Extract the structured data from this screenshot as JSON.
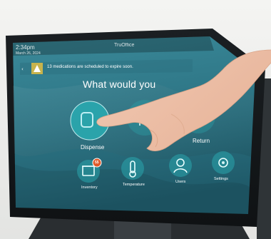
{
  "status_bar": {
    "time": "2:34pm",
    "date": "March 26, 2024",
    "brand": "TruOffice"
  },
  "alert": {
    "message": "13 medications are scheduled to expire soon."
  },
  "main": {
    "heading": "What would you"
  },
  "big_tiles": [
    {
      "label": "Dispense",
      "icon": "hand-pill-icon"
    },
    {
      "label": "",
      "icon": "upload-icon"
    },
    {
      "label": "Return",
      "icon": "return-icon"
    }
  ],
  "small_tiles": [
    {
      "label": "Inventory",
      "icon": "box-icon",
      "badge": "55"
    },
    {
      "label": "Temperature",
      "icon": "thermometer-icon"
    },
    {
      "label": "Users",
      "icon": "user-icon"
    },
    {
      "label": "Settings",
      "icon": "gear-icon"
    }
  ],
  "colors": {
    "screen_top": "#3f8fa0",
    "screen_bottom": "#1f5e6e",
    "tile_fill": "#2aa6ad",
    "alert_bar": "#b7a94a",
    "badge": "#e05a2a"
  }
}
